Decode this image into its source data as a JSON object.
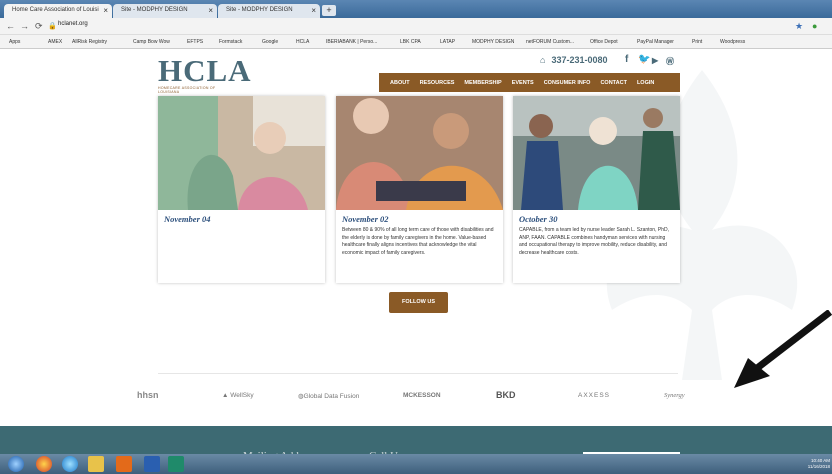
{
  "browser": {
    "tabs": [
      {
        "label": "Home Care Association of Louisi",
        "icon": "hcla-favicon"
      },
      {
        "label": "Site - MODPHY DESIGN",
        "icon": "globe-favicon"
      },
      {
        "label": "Site - MODPHY DESIGN",
        "icon": "globe-favicon"
      }
    ],
    "url": "hclanet.org",
    "bookmarks": [
      "Apps",
      "AMEX",
      "AllRisk Registry",
      "Camp Bow Wow",
      "EFTPS",
      "Formstack",
      "Google",
      "HCLA",
      "IBERIABANK | Perso...",
      "LBK CPA",
      "LATAP",
      "MODPHY DESIGN",
      "netFORUM Custom...",
      "Office Depot",
      "PayPal Manager",
      "Print",
      "Woodpress"
    ]
  },
  "site": {
    "logo": {
      "text": "HCLA",
      "subtitle": "HOMECARE ASSOCIATION OF LOUISIANA"
    },
    "phone": "337-231-0080",
    "menu": [
      "ABOUT",
      "RESOURCES",
      "MEMBERSHIP",
      "EVENTS",
      "CONSUMER INFO",
      "CONTACT",
      "LOGIN"
    ],
    "cards": [
      {
        "date": "November 04",
        "text": ""
      },
      {
        "date": "November 02",
        "text": "Between 80 & 90% of all long term care of those with disabilities and the elderly is done by family caregivers in the home. Value-based healthcare finally aligns incentives that acknowledge the vital economic impact of family caregivers."
      },
      {
        "date": "October 30",
        "text": "CAPABLE, from a team led by nurse leader Sarah L. Szanton, PhD, ANP, FAAN. CAPABLE combines handyman services with nursing and occupational therapy to improve mobility, reduce disability, and decrease healthcare costs."
      }
    ],
    "follow_label": "FOLLOW US",
    "partners": [
      "hhsn",
      "WellSky",
      "Global Data Fusion",
      "MCKESSON",
      "BKD",
      "AXXESS",
      "Synergy"
    ],
    "footer": {
      "mailing": "Mailing Address",
      "call": "Call Us"
    }
  },
  "taskbar": {
    "time": "10:40 AM",
    "date": "11/16/2018"
  },
  "colors": {
    "brand": "#8a5a26",
    "logo": "#4a6a78",
    "footer": "#3d6a73",
    "date": "#2c4f7c"
  }
}
